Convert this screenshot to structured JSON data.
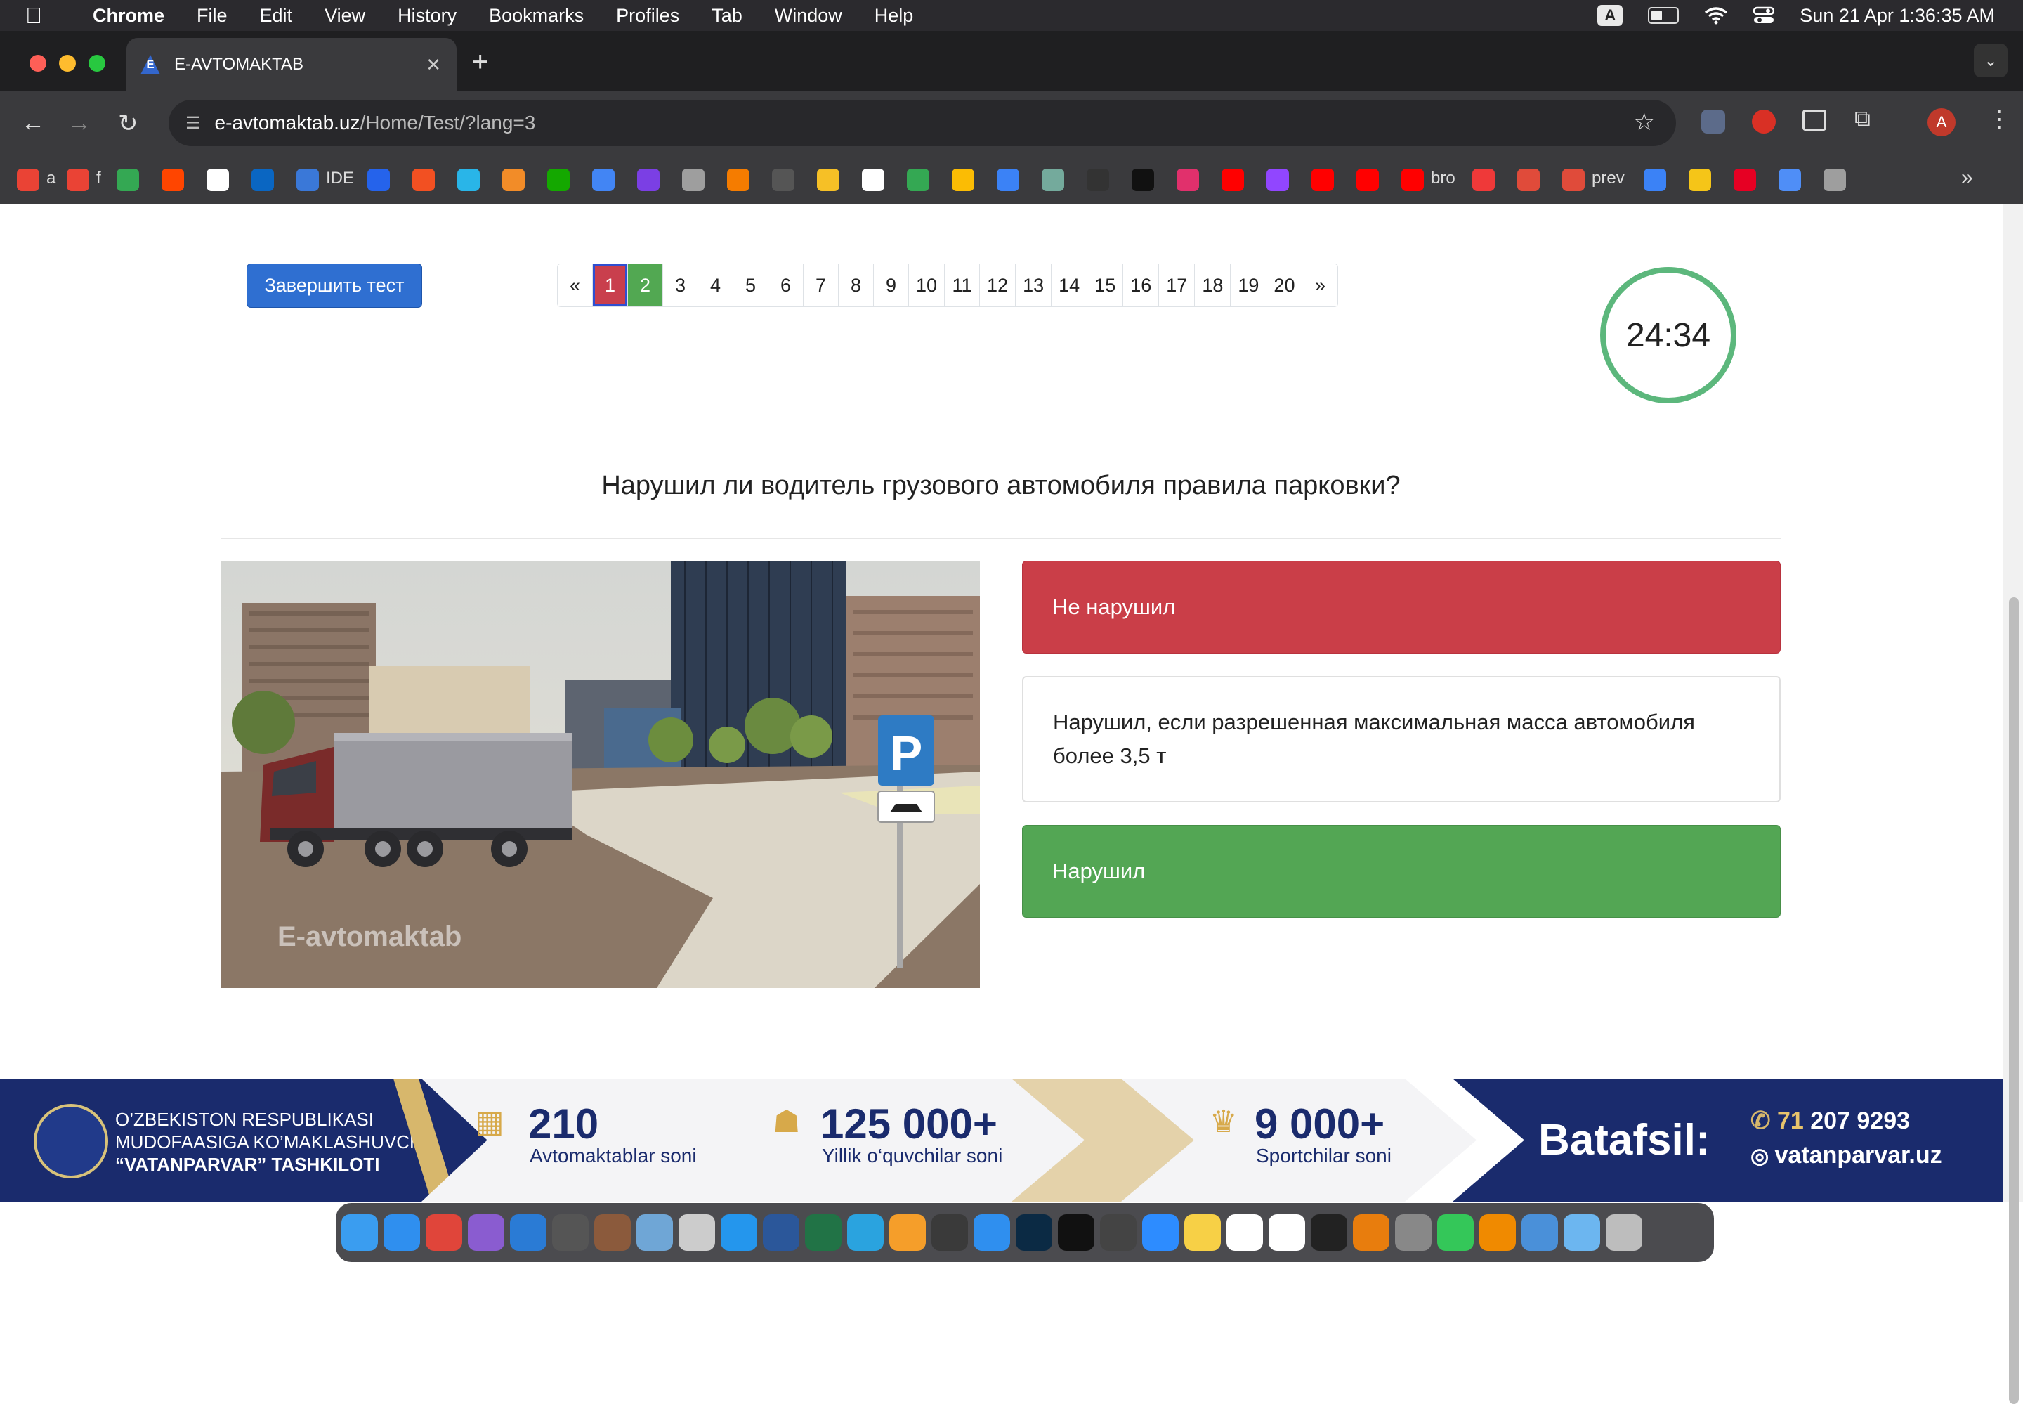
{
  "menubar": {
    "app": "Chrome",
    "menus": [
      "File",
      "Edit",
      "View",
      "History",
      "Bookmarks",
      "Profiles",
      "Tab",
      "Window",
      "Help"
    ],
    "input_badge": "A",
    "datetime": "Sun 21 Apr  1:36:35 AM"
  },
  "browser": {
    "tab_title": "E-AVTOMAKTAB",
    "tab_favicon": "E",
    "url_domain": "e-avtomaktab.uz",
    "url_path": "/Home/Test/?lang=3",
    "profile_initial": "A",
    "bookmarks": [
      {
        "icon": "gmail-icon",
        "label": "a",
        "color": "#ea4335"
      },
      {
        "icon": "gmail-icon",
        "label": "f",
        "color": "#ea4335"
      },
      {
        "icon": "meet-icon",
        "label": "",
        "color": "#34a853"
      },
      {
        "icon": "reddit-icon",
        "label": "",
        "color": "#ff4500"
      },
      {
        "icon": "github-icon",
        "label": "",
        "color": "#ffffff"
      },
      {
        "icon": "linkedin-icon",
        "label": "",
        "color": "#0a66c2"
      },
      {
        "icon": "sql-icon",
        "label": "IDE",
        "color": "#3a78d8"
      },
      {
        "icon": "mars-icon",
        "label": "",
        "color": "#2563eb"
      },
      {
        "icon": "microsoft-icon",
        "label": "",
        "color": "#f25022"
      },
      {
        "icon": "snowflake-icon",
        "label": "",
        "color": "#29b5e8"
      },
      {
        "icon": "cube-icon",
        "label": "",
        "color": "#f28c28"
      },
      {
        "icon": "upwork-icon",
        "label": "",
        "color": "#14a800"
      },
      {
        "icon": "docs-icon",
        "label": "",
        "color": "#4285f4"
      },
      {
        "icon": "shield-u-icon",
        "label": "",
        "color": "#7b3fe4"
      },
      {
        "icon": "globe-icon",
        "label": "",
        "color": "#9e9e9e"
      },
      {
        "icon": "runner-icon",
        "label": "",
        "color": "#f57c00"
      },
      {
        "icon": "hd-icon",
        "label": "",
        "color": "#555555"
      },
      {
        "icon": "sunglasses-icon",
        "label": "",
        "color": "#f6c026"
      },
      {
        "icon": "google-icon",
        "label": "",
        "color": "#ffffff"
      },
      {
        "icon": "maps-icon",
        "label": "",
        "color": "#34a853"
      },
      {
        "icon": "photos-icon",
        "label": "",
        "color": "#fbbc04"
      },
      {
        "icon": "chat-icon",
        "label": "",
        "color": "#3b82f6"
      },
      {
        "icon": "openai-icon",
        "label": "",
        "color": "#74aa9c"
      },
      {
        "icon": "mt-icon",
        "label": "",
        "color": "#333333"
      },
      {
        "icon": "tiktok-icon",
        "label": "",
        "color": "#111111"
      },
      {
        "icon": "instagram-icon",
        "label": "",
        "color": "#e1306c"
      },
      {
        "icon": "youtube-icon",
        "label": "",
        "color": "#ff0000"
      },
      {
        "icon": "twitch-icon",
        "label": "",
        "color": "#9146ff"
      },
      {
        "icon": "youtube-icon",
        "label": "",
        "color": "#ff0000"
      },
      {
        "icon": "youtube-icon",
        "label": "",
        "color": "#ff0000"
      },
      {
        "icon": "youtube-icon",
        "label": "bro",
        "color": "#ff0000"
      },
      {
        "icon": "vivaldi-icon",
        "label": "",
        "color": "#ef3939"
      },
      {
        "icon": "chart-icon",
        "label": "",
        "color": "#e04b3a"
      },
      {
        "icon": "chart-icon",
        "label": "prev",
        "color": "#e04b3a"
      },
      {
        "icon": "c-icon",
        "label": "",
        "color": "#3b82f6"
      },
      {
        "icon": "blocks-icon",
        "label": "",
        "color": "#f5c518"
      },
      {
        "icon": "pinterest-icon",
        "label": "",
        "color": "#e60023"
      },
      {
        "icon": "sparkle-icon",
        "label": "",
        "color": "#4f8ef7"
      },
      {
        "icon": "globe-icon",
        "label": "",
        "color": "#9e9e9e"
      }
    ]
  },
  "test": {
    "finish_label": "Завершить тест",
    "pagination": {
      "prev": "«",
      "next": "»",
      "pages": [
        "1",
        "2",
        "3",
        "4",
        "5",
        "6",
        "7",
        "8",
        "9",
        "10",
        "11",
        "12",
        "13",
        "14",
        "15",
        "16",
        "17",
        "18",
        "19",
        "20"
      ],
      "current": "1",
      "current_color": "#c93f4d",
      "answered_correct": [
        "2"
      ],
      "answered_color": "#52a852"
    },
    "timer": "24:34",
    "question": "Нарушил ли водитель грузового автомобиля правила парковки?",
    "image_watermark": "E-avtomaktab",
    "parking_sign": "P",
    "answers": [
      {
        "text": "Не нарушил",
        "state": "wrong",
        "color": "#ca3e48"
      },
      {
        "text": "Нарушил, если разрешенная максимальная масса автомобиля более 3,5 т",
        "state": "neutral",
        "color": "#ffffff"
      },
      {
        "text": "Нарушил",
        "state": "correct",
        "color": "#53a654"
      }
    ]
  },
  "banner": {
    "org_line1": "O’ZBEKISTON RESPUBLIKASI",
    "org_line2": "MUDOFAASIGA KO’MAKLASHUVCHI",
    "org_line3": "“VATANPARVAR” TASHKILOTI",
    "stats": [
      {
        "value": "210",
        "label": "Avtomaktablar soni",
        "icon": "building-icon"
      },
      {
        "value": "125 000+",
        "label": "Yillik o‘quvchilar soni",
        "icon": "people-icon"
      },
      {
        "value": "9 000+",
        "label": "Sportchilar soni",
        "icon": "trophy-icon"
      }
    ],
    "more": "Batafsil:",
    "phone_code": "71",
    "phone_number": " 207 9293",
    "website": "vatanparvar.uz"
  },
  "dock": {
    "apps": [
      {
        "icon": "finder-icon",
        "color": "#3a9df0"
      },
      {
        "icon": "safari-icon",
        "color": "#2f8fef"
      },
      {
        "icon": "chrome-icon",
        "color": "#e0453a"
      },
      {
        "icon": "visual-studio-icon",
        "color": "#8a5cd0"
      },
      {
        "icon": "vscode-icon",
        "color": "#2a7bd5"
      },
      {
        "icon": "textedit-icon",
        "color": "#555555"
      },
      {
        "icon": "app-icon",
        "color": "#8b5a3c"
      },
      {
        "icon": "preview-icon",
        "color": "#6fa6d6"
      },
      {
        "icon": "app-icon",
        "color": "#cccccc"
      },
      {
        "icon": "docker-icon",
        "color": "#2496ed"
      },
      {
        "icon": "word-icon",
        "color": "#2b579a"
      },
      {
        "icon": "excel-icon",
        "color": "#217346"
      },
      {
        "icon": "telegram-icon",
        "color": "#2aa3df"
      },
      {
        "icon": "pages-icon",
        "color": "#f59e2a"
      },
      {
        "icon": "xcode-icon",
        "color": "#3a3a3a"
      },
      {
        "icon": "app-store-icon",
        "color": "#2f8fef"
      },
      {
        "icon": "photoshop-icon",
        "color": "#0b2a44"
      },
      {
        "icon": "capcut-icon",
        "color": "#111111"
      },
      {
        "icon": "final-cut-icon",
        "color": "#444444"
      },
      {
        "icon": "zoom-icon",
        "color": "#2d8cff"
      },
      {
        "icon": "notes-icon",
        "color": "#f7d046"
      },
      {
        "icon": "notion-icon",
        "color": "#ffffff"
      },
      {
        "icon": "calendar-icon",
        "color": "#ffffff"
      },
      {
        "icon": "unity-icon",
        "color": "#222222"
      },
      {
        "icon": "blender-icon",
        "color": "#e87d0d"
      },
      {
        "icon": "settings-icon",
        "color": "#888888"
      },
      {
        "icon": "facetime-icon",
        "color": "#34c759"
      },
      {
        "icon": "vlc-icon",
        "color": "#f08a00"
      },
      {
        "icon": "quicktime-icon",
        "color": "#4a90d9"
      },
      {
        "icon": "downloads-folder-icon",
        "color": "#6cb6f0"
      },
      {
        "icon": "trash-icon",
        "color": "#bdbdbd"
      }
    ]
  }
}
